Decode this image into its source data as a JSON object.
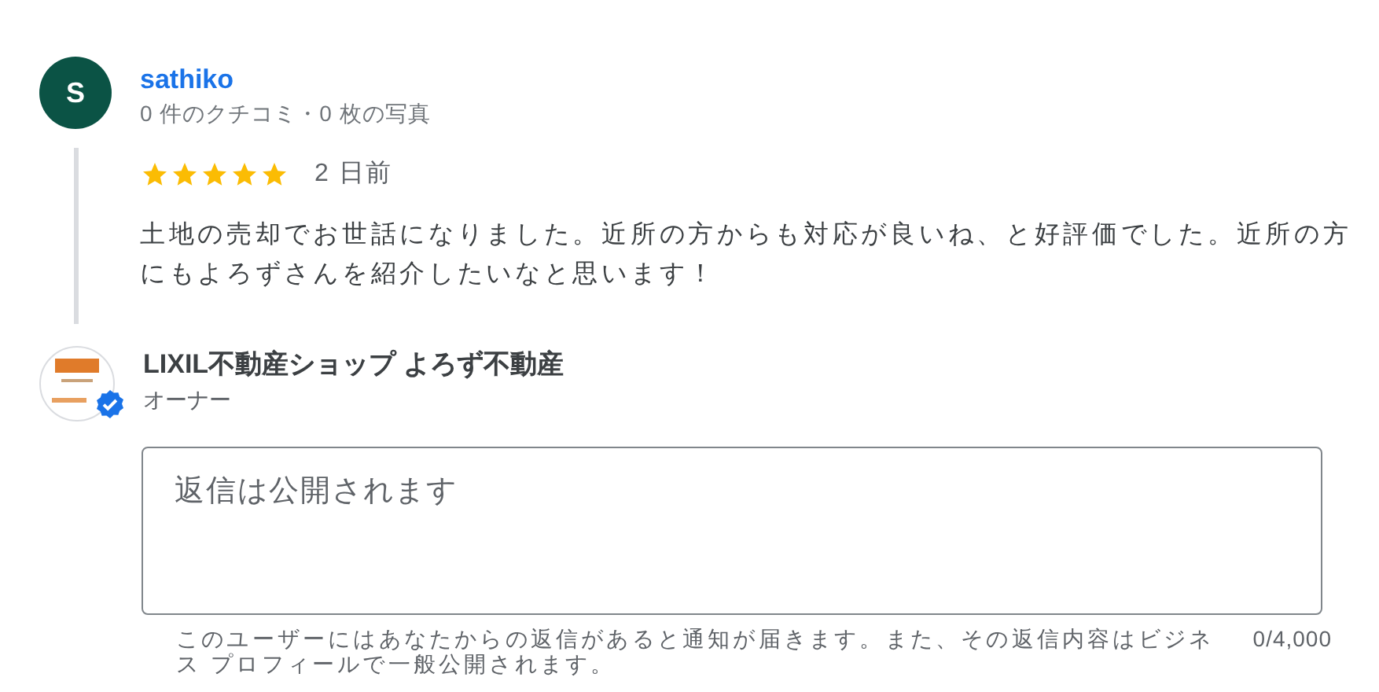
{
  "review": {
    "avatar_letter": "S",
    "author": "sathiko",
    "meta": "0 件のクチコミ・0 枚の写真",
    "stars": 5,
    "time": "2 日前",
    "text": "土地の売却でお世話になりました。近所の方からも対応が良いね、と好評価でした。近所の方にもよろずさんを紹介したいなと思います！"
  },
  "owner": {
    "name": "LIXIL不動産ショップ よろず不動産",
    "role": "オーナー",
    "verified": true
  },
  "reply": {
    "placeholder": "返信は公開されます",
    "hint": "このユーザーにはあなたからの返信があると通知が届きます。また、その返信内容はビジネス プロフィールで一般公開されます。",
    "counter": "0/4,000"
  }
}
